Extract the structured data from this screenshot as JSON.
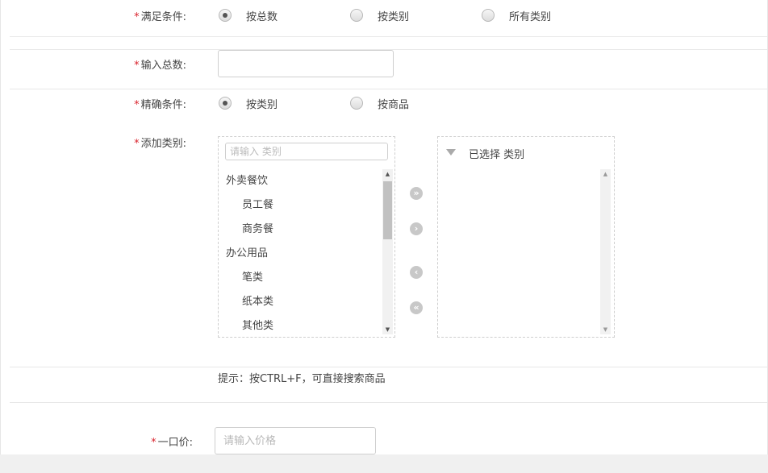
{
  "form": {
    "condition": {
      "label": "满足条件:",
      "options": [
        "按总数",
        "按类别",
        "所有类别"
      ],
      "selected": 0
    },
    "total": {
      "label": "输入总数:",
      "value": ""
    },
    "precise": {
      "label": "精确条件:",
      "options": [
        "按类别",
        "按商品"
      ],
      "selected": 0
    },
    "add_category": {
      "label": "添加类别:",
      "search_placeholder": "请输入 类别",
      "items": [
        {
          "label": "外卖餐饮",
          "level": "group"
        },
        {
          "label": "员工餐",
          "level": "child"
        },
        {
          "label": "商务餐",
          "level": "child"
        },
        {
          "label": "办公用品",
          "level": "group"
        },
        {
          "label": "笔类",
          "level": "child"
        },
        {
          "label": "纸本类",
          "level": "child"
        },
        {
          "label": "其他类",
          "level": "child"
        }
      ],
      "selected_title": "已选择 类别",
      "controls": {
        "add_all": "»",
        "add": "›",
        "remove": "‹",
        "remove_all": "«"
      }
    },
    "hint": "提示：按CTRL+F，可直接搜索商品",
    "price": {
      "label": "一口价:",
      "placeholder": "请输入价格",
      "value": ""
    }
  },
  "colors": {
    "required": "#d9232d",
    "border": "#cfcfcf",
    "control": "#c8c8c8"
  }
}
